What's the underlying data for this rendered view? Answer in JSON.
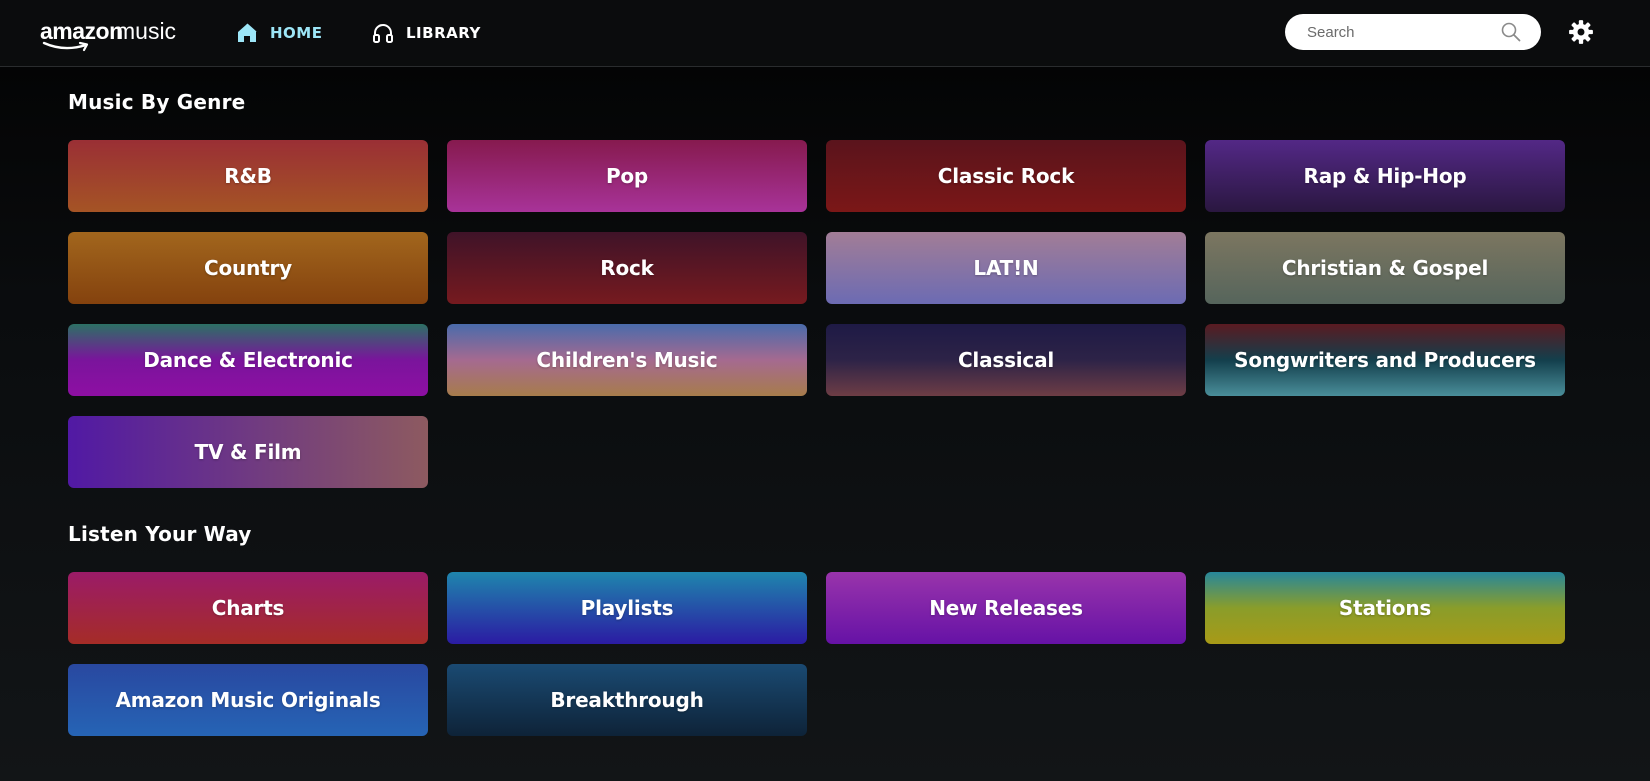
{
  "header": {
    "logo": {
      "word1": "amazon",
      "word2": "music"
    },
    "nav": [
      {
        "label": "HOME",
        "icon": "home-icon",
        "active": true
      },
      {
        "label": "LIBRARY",
        "icon": "headphones-icon",
        "active": false
      }
    ],
    "search": {
      "placeholder": "Search",
      "value": ""
    },
    "settings_icon": "gear-icon",
    "active_color": "#9de6f7"
  },
  "sections": [
    {
      "title": "Music By Genre",
      "tiles": [
        {
          "label": "R&B",
          "gradient": [
            "#9a2f35",
            "#a55425"
          ]
        },
        {
          "label": "Pop",
          "gradient": [
            "#861a4e",
            "#a83399"
          ]
        },
        {
          "label": "Classic Rock",
          "gradient": [
            "#5a141c",
            "#7b1717"
          ]
        },
        {
          "label": "Rap & Hip-Hop",
          "gradient": [
            "#532886",
            "#2a1740"
          ]
        },
        {
          "label": "Country",
          "gradient": [
            "#a2661d",
            "#84420e"
          ]
        },
        {
          "label": "Rock",
          "gradient": [
            "#3f1328",
            "#761a1f"
          ]
        },
        {
          "label": "LAT!N",
          "gradient": [
            "#a27d96",
            "#6c6bb3"
          ]
        },
        {
          "label": "Christian & Gospel",
          "gradient": [
            "#7c7660",
            "#56655c"
          ]
        },
        {
          "label": "Dance & Electronic",
          "gradient": [
            "#2c7164",
            "#7a149c",
            "#8e0fa3"
          ]
        },
        {
          "label": "Children's Music",
          "gradient": [
            "#4a6bab",
            "#a56a90",
            "#a77c4b"
          ]
        },
        {
          "label": "Classical",
          "gradient": [
            "#1e1a45",
            "#2d2347",
            "#6e3d45"
          ]
        },
        {
          "label": "Songwriters and Producers",
          "gradient": [
            "#5a1a21",
            "#133f4c",
            "#4a8e9a"
          ]
        },
        {
          "label": "TV & Film",
          "gradient": [
            "#5119a4",
            "#8d5a60"
          ],
          "direction": "90deg"
        }
      ]
    },
    {
      "title": "Listen Your Way",
      "tiles": [
        {
          "label": "Charts",
          "gradient": [
            "#9b1b68",
            "#a52c27"
          ]
        },
        {
          "label": "Playlists",
          "gradient": [
            "#1f86ad",
            "#2b1ba3"
          ]
        },
        {
          "label": "New Releases",
          "gradient": [
            "#9934ab",
            "#6612a6"
          ]
        },
        {
          "label": "Stations",
          "gradient": [
            "#27879b",
            "#8a9d2a",
            "#a89a17"
          ]
        },
        {
          "label": "Amazon Music Originals",
          "gradient": [
            "#2948a0",
            "#2664b5"
          ]
        },
        {
          "label": "Breakthrough",
          "gradient": [
            "#1a4a72",
            "#0e2338"
          ]
        }
      ]
    }
  ]
}
